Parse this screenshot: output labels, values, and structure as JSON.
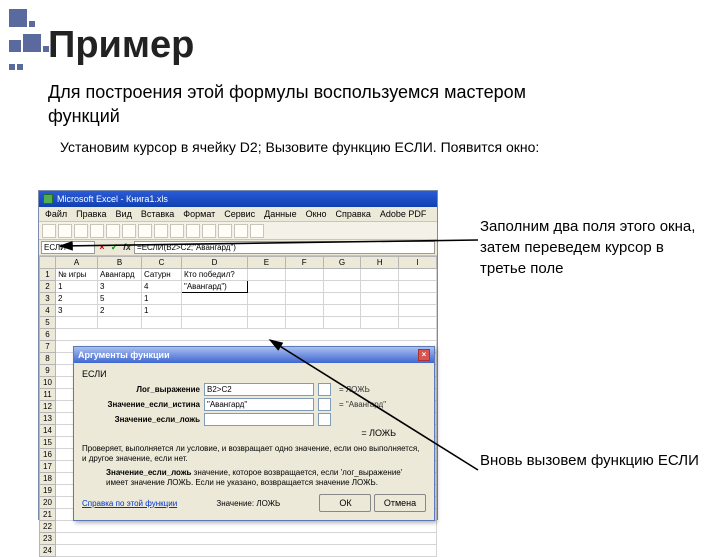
{
  "slide": {
    "title": "Пример",
    "subtitle": "Для построения этой формулы воспользуемся мастером функций",
    "step": "Установим курсор в ячейку D2; Вызовите функцию ЕСЛИ. Появится окно:",
    "annot1": "Заполним два поля этого окна, затем переведем курсор в третье поле",
    "annot2": "Вновь вызовем функцию ЕСЛИ"
  },
  "excel": {
    "title": "Microsoft Excel - Книга1.xls",
    "menu": [
      "Файл",
      "Правка",
      "Вид",
      "Вставка",
      "Формат",
      "Сервис",
      "Данные",
      "Окно",
      "Справка",
      "Adobe PDF"
    ],
    "namebox": "ЕСЛИ",
    "fx_buttons": {
      "cancel": "×",
      "enter": "✓",
      "fx": "fx"
    },
    "formula": "=ЕСЛИ(B2>C2;\"Авангард\")",
    "columns": [
      "",
      "A",
      "B",
      "C",
      "D",
      "E",
      "F",
      "G",
      "H",
      "I"
    ],
    "rows": [
      {
        "r": "1",
        "c": [
          "№ игры",
          "Авангард",
          "Сатурн",
          "Кто победил?",
          "",
          "",
          "",
          "",
          ""
        ]
      },
      {
        "r": "2",
        "c": [
          "1",
          "3",
          "4",
          "\"Авангард\")",
          "",
          "",
          "",
          "",
          ""
        ]
      },
      {
        "r": "3",
        "c": [
          "2",
          "5",
          "1",
          "",
          "",
          "",
          "",
          "",
          ""
        ]
      },
      {
        "r": "4",
        "c": [
          "3",
          "2",
          "1",
          "",
          "",
          "",
          "",
          "",
          ""
        ]
      },
      {
        "r": "5",
        "c": [
          "",
          "",
          "",
          "",
          "",
          "",
          "",
          "",
          ""
        ]
      }
    ],
    "row_labels_rest": [
      "6",
      "7",
      "8",
      "9",
      "10",
      "11",
      "12",
      "13",
      "14",
      "15",
      "16",
      "17",
      "18",
      "19",
      "20",
      "21",
      "22",
      "23",
      "24"
    ]
  },
  "dialog": {
    "title": "Аргументы функции",
    "close": "×",
    "fname": "ЕСЛИ",
    "fields": {
      "f1_label": "Лог_выражение",
      "f1_value": "B2>C2",
      "f1_eval": "= ЛОЖЬ",
      "f2_label": "Значение_если_истина",
      "f2_value": "\"Авангард\"",
      "f2_eval": "= \"Авангард\"",
      "f3_label": "Значение_если_ложь",
      "f3_value": "",
      "f3_eval": ""
    },
    "result_eq": "= ЛОЖЬ",
    "desc": "Проверяет, выполняется ли условие, и возвращает одно значение, если оно выполняется, и другое значение, если нет.",
    "arg_desc_label": "Значение_если_ложь",
    "arg_desc": "значение, которое возвращается, если 'лог_выражение' имеет значение ЛОЖЬ. Если не указано, возвращается значение ЛОЖЬ.",
    "help": "Справка по этой функции",
    "result_label": "Значение:",
    "result_value": "ЛОЖЬ",
    "ok": "ОК",
    "cancel": "Отмена"
  }
}
